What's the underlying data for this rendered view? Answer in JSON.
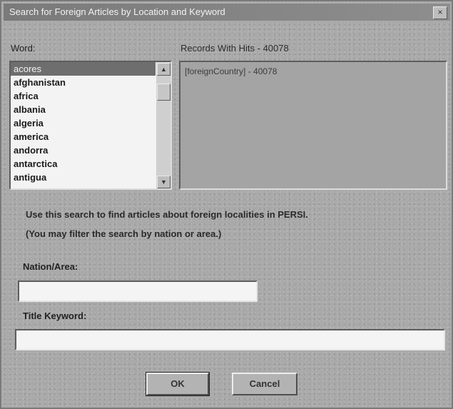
{
  "window": {
    "title": "Search for Foreign Articles by Location and Keyword",
    "close_glyph": "×"
  },
  "word_list": {
    "label": "Word:",
    "items": [
      "acores",
      "afghanistan",
      "africa",
      "albania",
      "algeria",
      "america",
      "andorra",
      "antarctica",
      "antigua"
    ],
    "selected_index": 0
  },
  "results": {
    "label": "Records With Hits - 40078",
    "items": [
      "[foreignCountry] - 40078"
    ]
  },
  "instructions": {
    "line1": "Use this search to find articles about foreign localities in PERSI.",
    "line2": "(You may filter the search by nation or area.)"
  },
  "nation_area": {
    "label": "Nation/Area:",
    "value": ""
  },
  "title_keyword": {
    "label": "Title Keyword:",
    "value": ""
  },
  "buttons": {
    "ok_label": "OK",
    "cancel_label": "Cancel"
  },
  "icons": {
    "close": "close-icon",
    "scroll_up": "scroll-up-arrow-icon",
    "scroll_down": "scroll-down-arrow-icon"
  }
}
